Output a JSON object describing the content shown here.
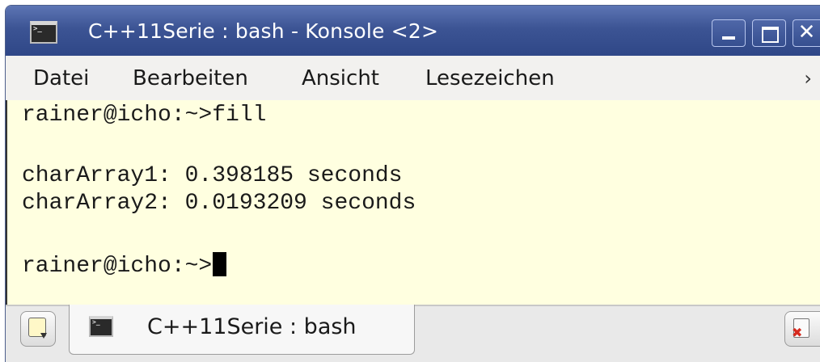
{
  "window": {
    "title": "C++11Serie : bash - Konsole <2>",
    "app_icon_glyph": ">_",
    "buttons": {
      "minimize": "",
      "maximize": "",
      "close": "✕"
    }
  },
  "menubar": {
    "items": [
      "Datei",
      "Bearbeiten",
      "Ansicht",
      "Lesezeichen"
    ],
    "more": "›"
  },
  "terminal": {
    "lines": [
      "rainer@icho:~>fill",
      "",
      "charArray1: 0.398185 seconds",
      "charArray2: 0.0193209 seconds",
      "",
      "rainer@icho:~>"
    ],
    "background": "#ffffe0"
  },
  "tabbar": {
    "tabs": [
      {
        "label": "C++11Serie : bash",
        "icon": "terminal-icon",
        "icon_glyph": ">_"
      }
    ],
    "new_tab_icon": "new-tab-icon",
    "close_tab_icon": "close-tab-icon"
  },
  "colors": {
    "titlebar": "#3c5494",
    "terminal_bg": "#ffffe0",
    "text": "#1a1a1a",
    "close_accent": "#d62a1e"
  }
}
